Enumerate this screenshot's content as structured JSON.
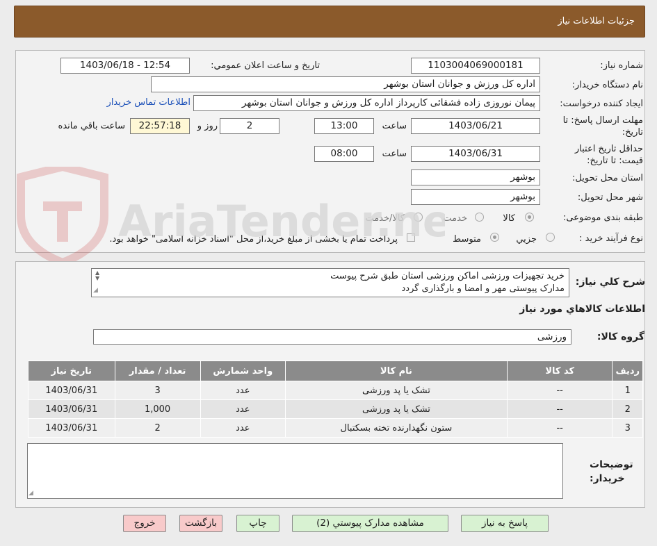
{
  "header": {
    "title": "جزئیات اطلاعات نیاز"
  },
  "form": {
    "need_number_label": "شماره نیاز:",
    "need_number": "1103004069000181",
    "announce_label": "تاریخ و ساعت اعلان عمومي:",
    "announce_value": "1403/06/18 - 12:54",
    "buyer_org_label": "نام دستگاه خریدار:",
    "buyer_org": "اداره کل ورزش و جوانان استان بوشهر",
    "requester_label": "ایجاد کننده درخواست:",
    "requester": "پیمان نوروزی زاده فشقائی کارپرداز اداره کل ورزش و جوانان استان بوشهر",
    "contact_link": "اطلاعات تماس خریدار",
    "deadline_label": "مهلت ارسال پاسخ: تا تاریخ:",
    "deadline_date": "1403/06/21",
    "time_label": "ساعت",
    "deadline_time": "13:00",
    "days_value": "2",
    "days_label": "روز و",
    "remaining_value": "22:57:18",
    "remaining_label": "ساعت باقي مانده",
    "validity_label": "حداقل تاریخ اعتبار قیمت: تا تاریخ:",
    "validity_date": "1403/06/31",
    "validity_time": "08:00",
    "province_label": "استان محل تحویل:",
    "province": "بوشهر",
    "city_label": "شهر محل تحویل:",
    "city": "بوشهر",
    "category_label": "طبقه بندی موضوعی:",
    "category_options": [
      "کالا",
      "خدمت",
      "کالا/خدمت"
    ],
    "category_selected": "کالا",
    "process_label": "نوع فرآیند خرید :",
    "process_options": [
      "جزیي",
      "متوسط"
    ],
    "process_selected": "متوسط",
    "treasury_note": "پرداخت تمام یا بخشی از مبلغ خرید،از محل \"اسناد خزانه اسلامی\" خواهد بود."
  },
  "details": {
    "summary_label": "شرح کلي نیاز:",
    "summary_line1": "خرید تجهیزات ورزشی اماکن ورزشی استان طبق شرح پیوست",
    "summary_line2": "مدارک پیوستی مهر و امضا و بارگذاری گردد",
    "items_heading": "اطلاعات کالاهاي مورد نیاز",
    "group_label": "گروه کالا:",
    "group_value": "ورزشی",
    "table": {
      "headers": [
        "ردیف",
        "کد کالا",
        "نام کالا",
        "واحد شمارش",
        "تعداد / مقدار",
        "تاریخ نیاز"
      ],
      "rows": [
        [
          "1",
          "--",
          "تشک یا پد ورزشی",
          "عدد",
          "3",
          "1403/06/31"
        ],
        [
          "2",
          "--",
          "تشک یا پد ورزشی",
          "عدد",
          "1,000",
          "1403/06/31"
        ],
        [
          "3",
          "--",
          "ستون نگهدارنده تخته بسکتبال",
          "عدد",
          "2",
          "1403/06/31"
        ]
      ]
    },
    "buyer_notes_label": "توضیحات خریدار:",
    "buyer_notes": ""
  },
  "buttons": {
    "respond": "پاسخ به نیاز",
    "attachments": "مشاهده مدارک پیوستي (2)",
    "print": "چاپ",
    "back": "بازگشت",
    "exit": "خروج"
  },
  "watermark": {
    "text": "AriaTender.neT"
  },
  "colors": {
    "header": "#8b5a2b",
    "table_header": "#8b8b8b",
    "link": "#1a4fb8",
    "green_button": "#d8f2d2",
    "pink_button": "#f8caca"
  }
}
